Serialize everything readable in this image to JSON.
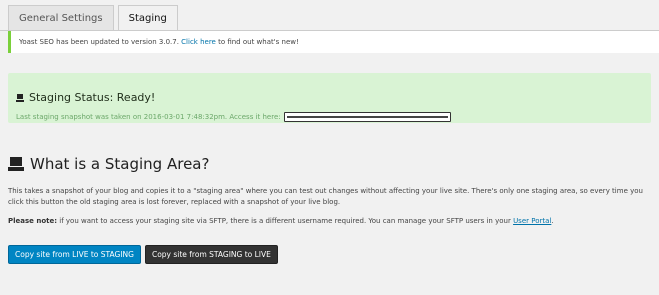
{
  "tabs": [
    {
      "label": "General Settings",
      "active": false
    },
    {
      "label": "Staging",
      "active": true
    }
  ],
  "notice": {
    "text_before": "Yoast SEO has been updated to version 3.0.7. ",
    "link_text": "Click here",
    "text_after": " to find out what's new!"
  },
  "status": {
    "title": "Staging Status: Ready!",
    "snapshot_text": "Last staging snapshot was taken on 2016-03-01 7:48:32pm. Access it here:",
    "icon": "server-drive-icon"
  },
  "section": {
    "heading": "What is a Staging Area?",
    "heading_icon": "server-drive-icon",
    "description": "This takes a snapshot of your blog and copies it to a \"staging area\" where you can test out changes without affecting your live site. There's only one staging area, so every time you click this button the old staging area is lost forever, replaced with a snapshot of your live blog.",
    "note_label": "Please note:",
    "note_text": " if you want to access your staging site via SFTP, there is a different username required. You can manage your SFTP users in your ",
    "note_link": "User Portal",
    "note_end": "."
  },
  "buttons": {
    "live_to_staging": "Copy site from LIVE to STAGING",
    "staging_to_live": "Copy site from STAGING to LIVE"
  },
  "colors": {
    "status_bg": "#d9f3d4",
    "notice_border": "#7ad03a",
    "btn_blue": "#0085c3",
    "btn_dark": "#333333",
    "link": "#0073aa"
  }
}
